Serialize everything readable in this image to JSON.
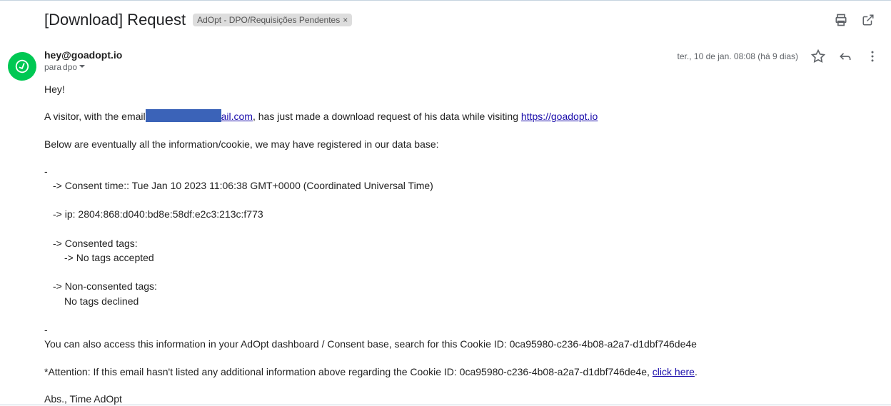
{
  "subject": "[Download] Request",
  "label": "AdOpt - DPO/Requisições Pendentes",
  "from": "hey@goadopt.io",
  "to_prefix": "para",
  "to": "dpo",
  "timestamp": "ter., 10 de jan. 08:08 (há 9 dias)",
  "body": {
    "greeting": "Hey!",
    "visitor_prefix": "A visitor, with the email",
    "email_fragment": "ail.com",
    "visitor_mid": ", has just made a download request of his data while visiting ",
    "visitor_link": "https://goadopt.io",
    "below_info": "Below are eventually all the information/cookie, we may have registered in our data base:",
    "consent_time": "-> Consent time:: Tue Jan 10 2023 11:06:38 GMT+0000 (Coordinated Universal Time)",
    "ip": "-> ip: 2804:868:d040:bd8e:58df:e2c3:213c:f773",
    "consented_header": "-> Consented tags:",
    "consented_value": "    -> No tags accepted",
    "nonconsented_header": "-> Non-consented tags:",
    "nonconsented_value": "    No tags declined",
    "dashboard_line": "You can also access this information in your AdOpt dashboard / Consent base, search for this Cookie ID: 0ca95980-c236-4b08-a2a7-d1dbf746de4e",
    "attention_prefix": "*Attention: If this email hasn't listed any additional information above regarding the Cookie ID: 0ca95980-c236-4b08-a2a7-d1dbf746de4e, ",
    "attention_link": "click here",
    "attention_suffix": ".",
    "signoff": "Abs., Time AdOpt",
    "dash": "-"
  }
}
